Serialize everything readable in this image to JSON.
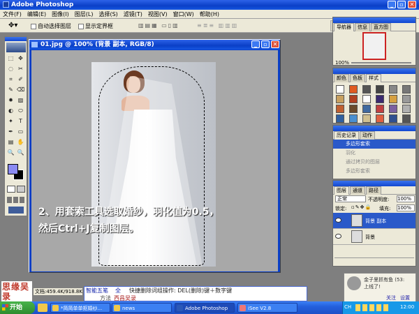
{
  "app": {
    "title": "Adobe Photoshop"
  },
  "menu": [
    "文件(F)",
    "编辑(E)",
    "图像(I)",
    "图层(L)",
    "选择(S)",
    "滤镜(T)",
    "视图(V)",
    "窗口(W)",
    "帮助(H)"
  ],
  "options": {
    "auto_select": "自动选择图层",
    "show_bounds": "显示定界框"
  },
  "doc": {
    "title": "01.jpg @ 100% (背景 副本, RGB/8)"
  },
  "caption": {
    "line1": "2、用套索工具选取婚纱，羽化值为0.5，",
    "line2": "然后Ctrl+J复制图层。"
  },
  "status": {
    "doc_size": "文档:459.4K/918.8K"
  },
  "navigator": {
    "tabs": [
      "导航器",
      "信息",
      "直方图"
    ],
    "zoom": "100%"
  },
  "swatches": {
    "tabs": [
      "颜色",
      "色板",
      "样式"
    ]
  },
  "history": {
    "tabs": [
      "历史记录",
      "动作"
    ],
    "items": [
      "多边形套索",
      "羽化",
      "通过拷贝的图层",
      "多边形套索"
    ]
  },
  "layers": {
    "tabs": [
      "图层",
      "通道",
      "路径"
    ],
    "mode": "正常",
    "opacity_label": "不透明度:",
    "opacity": "100%",
    "lock_label": "锁定:",
    "fill_label": "填充:",
    "fill": "100%",
    "items": [
      "背景 副本",
      "背景"
    ]
  },
  "ime": {
    "name": "智能五笔",
    "full": "全",
    "hint": "快捷删除词组操作: DEL(删除)键＋数字键",
    "method_label": "方法",
    "method": "西昌吴录"
  },
  "logo": {
    "text": "思缘吴录"
  },
  "notify": {
    "title": "金子里抓有鱼 (53:",
    "body": "上线了!",
    "a": "关注",
    "b": "设置"
  },
  "taskbar": {
    "items": [
      "开始",
      "*简简单单抠婚纱...",
      "news",
      "Adobe Photoshop",
      "iSee V2.8"
    ],
    "lang": "CH",
    "clock": "12:00"
  },
  "colors": {
    "titlebar": "#0a3fc7",
    "selected": "#2a59c9",
    "caption": "#ffffff",
    "workspace": "#7f7f7f"
  }
}
